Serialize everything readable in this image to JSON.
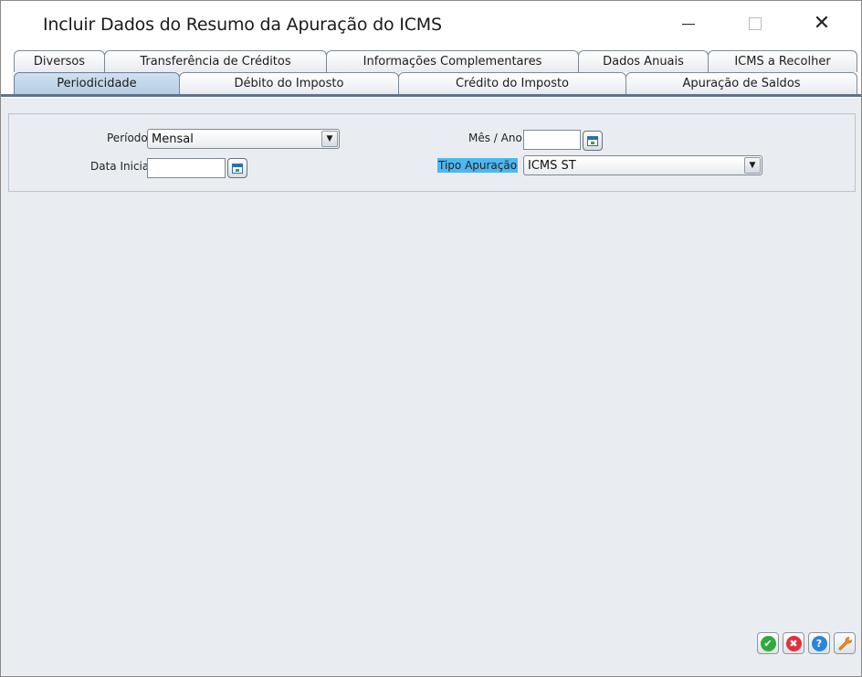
{
  "window": {
    "title": "Incluir Dados do Resumo da Apuração do ICMS",
    "close_glyph": "✕"
  },
  "tabs": {
    "row1": [
      {
        "label": "Diversos"
      },
      {
        "label": "Transferência de Créditos"
      },
      {
        "label": "Informações Complementares"
      },
      {
        "label": "Dados Anuais"
      },
      {
        "label": "ICMS a Recolher"
      }
    ],
    "row2": [
      {
        "label": "Periodicidade",
        "active": true
      },
      {
        "label": "Débito do Imposto"
      },
      {
        "label": "Crédito do Imposto"
      },
      {
        "label": "Apuração de Saldos"
      }
    ]
  },
  "form": {
    "periodo": {
      "label": "Período",
      "value": "Mensal"
    },
    "data_inicial": {
      "label": "Data Inicial",
      "value": ""
    },
    "mes_ano": {
      "label": "Mês / Ano",
      "value": ""
    },
    "tipo_apuracao": {
      "label": "Tipo Apuração",
      "value": "ICMS ST"
    },
    "dropdown_glyph": "▼"
  },
  "actions": {
    "confirm_glyph": "✔",
    "cancel_glyph": "✖",
    "help_glyph": "?"
  },
  "colors": {
    "highlight": "#4fb7f0",
    "confirm": "#2faa3c",
    "cancel": "#e0323a",
    "help": "#2a86d8",
    "tools": "#f08a1c"
  }
}
